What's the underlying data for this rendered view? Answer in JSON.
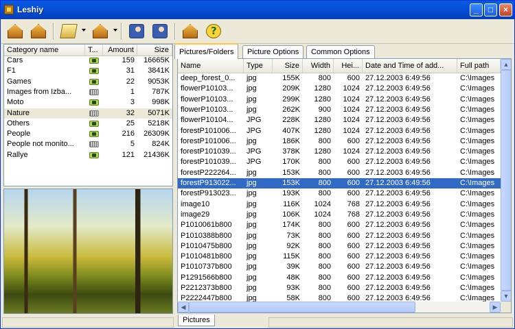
{
  "window": {
    "title": "Leshiy"
  },
  "toolbar": {
    "buttons": [
      {
        "icon": "house-photo-icon"
      },
      {
        "icon": "house-photo-icon"
      },
      {
        "icon": "open-book-icon"
      },
      {
        "icon": "add-house-icon"
      },
      {
        "icon": "person-photo-icon"
      },
      {
        "icon": "person-photo-icon"
      },
      {
        "icon": "home-icon"
      },
      {
        "icon": "help-icon"
      }
    ]
  },
  "categories": {
    "columns": [
      "Category name",
      "T...",
      "Amount",
      "Size"
    ],
    "rows": [
      {
        "name": "Cars",
        "type": "camera",
        "amount": "159",
        "size": "16665K"
      },
      {
        "name": "F1",
        "type": "camera",
        "amount": "31",
        "size": "3841K"
      },
      {
        "name": "Games",
        "type": "camera",
        "amount": "22",
        "size": "9053K"
      },
      {
        "name": "Images from Izba...",
        "type": "film",
        "amount": "1",
        "size": "787K"
      },
      {
        "name": "Moto",
        "type": "camera",
        "amount": "3",
        "size": "998K"
      },
      {
        "name": "Nature",
        "type": "film",
        "amount": "32",
        "size": "5071K",
        "selected": true
      },
      {
        "name": "Others",
        "type": "camera",
        "amount": "25",
        "size": "5218K"
      },
      {
        "name": "People",
        "type": "camera",
        "amount": "216",
        "size": "26309K"
      },
      {
        "name": "People not monito...",
        "type": "film",
        "amount": "5",
        "size": "824K"
      },
      {
        "name": "Rallye",
        "type": "camera",
        "amount": "121",
        "size": "21436K"
      }
    ]
  },
  "tabs": [
    "Pictures/Folders",
    "Picture Options",
    "Common Options"
  ],
  "files": {
    "columns": [
      "Name",
      "Type",
      "Size",
      "Width",
      "Hei...",
      "Date and Time of add...",
      "Full path"
    ],
    "rows": [
      [
        "deep_forest_0...",
        "jpg",
        "155K",
        "800",
        "600",
        "27.12.2003 6:49:56",
        "C:\\Images"
      ],
      [
        "flowerP10103...",
        "jpg",
        "209K",
        "1280",
        "1024",
        "27.12.2003 6:49:56",
        "C:\\Images"
      ],
      [
        "flowerP10103...",
        "jpg",
        "299K",
        "1280",
        "1024",
        "27.12.2003 6:49:56",
        "C:\\Images"
      ],
      [
        "flowerP10103...",
        "jpg",
        "262K",
        "900",
        "1024",
        "27.12.2003 6:49:56",
        "C:\\Images"
      ],
      [
        "flowerP10104...",
        "JPG",
        "228K",
        "1280",
        "1024",
        "27.12.2003 6:49:56",
        "C:\\Images"
      ],
      [
        "forestP101006...",
        "JPG",
        "407K",
        "1280",
        "1024",
        "27.12.2003 6:49:56",
        "C:\\Images"
      ],
      [
        "forestP101006...",
        "jpg",
        "186K",
        "800",
        "600",
        "27.12.2003 6:49:56",
        "C:\\Images"
      ],
      [
        "forestP101039...",
        "JPG",
        "378K",
        "1280",
        "1024",
        "27.12.2003 6:49:56",
        "C:\\Images"
      ],
      [
        "forestP101039...",
        "JPG",
        "170K",
        "800",
        "600",
        "27.12.2003 6:49:56",
        "C:\\Images"
      ],
      [
        "forestP222264...",
        "jpg",
        "153K",
        "800",
        "600",
        "27.12.2003 6:49:56",
        "C:\\Images"
      ],
      [
        "forestP913022...",
        "jpg",
        "153K",
        "800",
        "600",
        "27.12.2003 6:49:56",
        "C:\\Images"
      ],
      [
        "forestP913023...",
        "jpg",
        "193K",
        "800",
        "600",
        "27.12.2003 6:49:56",
        "C:\\Images"
      ],
      [
        "image10",
        "jpg",
        "116K",
        "1024",
        "768",
        "27.12.2003 6:49:56",
        "C:\\Images"
      ],
      [
        "image29",
        "jpg",
        "106K",
        "1024",
        "768",
        "27.12.2003 6:49:56",
        "C:\\Images"
      ],
      [
        "P1010061b800",
        "jpg",
        "174K",
        "800",
        "600",
        "27.12.2003 6:49:56",
        "C:\\Images"
      ],
      [
        "P1010388b800",
        "jpg",
        "73K",
        "800",
        "600",
        "27.12.2003 6:49:56",
        "C:\\Images"
      ],
      [
        "P1010475b800",
        "jpg",
        "92K",
        "800",
        "600",
        "27.12.2003 6:49:56",
        "C:\\Images"
      ],
      [
        "P1010481b800",
        "jpg",
        "115K",
        "800",
        "600",
        "27.12.2003 6:49:56",
        "C:\\Images"
      ],
      [
        "P1010737b800",
        "jpg",
        "39K",
        "800",
        "600",
        "27.12.2003 6:49:56",
        "C:\\Images"
      ],
      [
        "P1291566b800",
        "jpg",
        "48K",
        "800",
        "600",
        "27.12.2003 6:49:56",
        "C:\\Images"
      ],
      [
        "P2212373b800",
        "jpg",
        "93K",
        "800",
        "600",
        "27.12.2003 6:49:56",
        "C:\\Images"
      ],
      [
        "P2222447b800",
        "jpg",
        "58K",
        "800",
        "600",
        "27.12.2003 6:49:56",
        "C:\\Images"
      ]
    ],
    "selected_index": 10
  },
  "bottom_tab": {
    "label": "Pictures"
  },
  "colors": {
    "titlebar": "#0550d8",
    "selection": "#316ac5",
    "window_bg": "#ece9d8"
  }
}
